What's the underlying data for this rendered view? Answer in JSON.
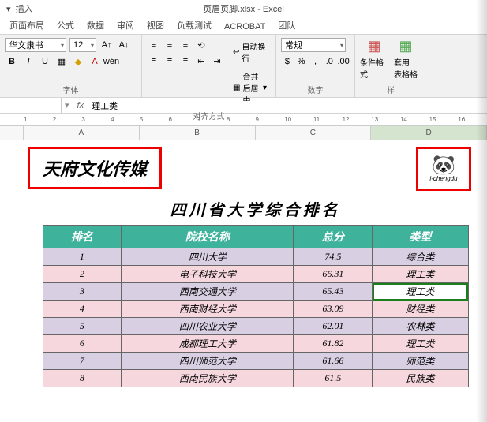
{
  "window": {
    "title": "页眉页脚.xlsx - Excel"
  },
  "qat": {
    "insert": "插入"
  },
  "tabs": [
    "页面布局",
    "公式",
    "数据",
    "审阅",
    "视图",
    "负载测试",
    "ACROBAT",
    "团队"
  ],
  "ribbon": {
    "font": {
      "name": "华文隶书",
      "size": "12",
      "label": "字体"
    },
    "align": {
      "wrap": "自动换行",
      "merge": "合并后居中",
      "label": "对齐方式"
    },
    "number": {
      "format": "常规",
      "label": "数字"
    },
    "styles": {
      "cond": "条件格式",
      "table": "套用\n表格格",
      "label": "样"
    }
  },
  "formula": {
    "cell": "",
    "fx": "fx",
    "value": "理工类"
  },
  "ruler": [
    "1",
    "2",
    "3",
    "4",
    "5",
    "6",
    "7",
    "8",
    "9",
    "10",
    "11",
    "12",
    "13",
    "14",
    "15",
    "16"
  ],
  "cols": [
    "A",
    "B",
    "C",
    "D"
  ],
  "header": {
    "left": "天府文化传媒",
    "brand": "i-chengdu"
  },
  "sheet_title": "四川省大学综合排名",
  "thead": [
    "排名",
    "院校名称",
    "总分",
    "类型"
  ],
  "rows": [
    {
      "rank": "1",
      "name": "四川大学",
      "score": "74.5",
      "type": "综合类"
    },
    {
      "rank": "2",
      "name": "电子科技大学",
      "score": "66.31",
      "type": "理工类"
    },
    {
      "rank": "3",
      "name": "西南交通大学",
      "score": "65.43",
      "type": "理工类"
    },
    {
      "rank": "4",
      "name": "西南财经大学",
      "score": "63.09",
      "type": "财经类"
    },
    {
      "rank": "5",
      "name": "四川农业大学",
      "score": "62.01",
      "type": "农林类"
    },
    {
      "rank": "6",
      "name": "成都理工大学",
      "score": "61.82",
      "type": "理工类"
    },
    {
      "rank": "7",
      "name": "四川师范大学",
      "score": "61.66",
      "type": "师范类"
    },
    {
      "rank": "8",
      "name": "西南民族大学",
      "score": "61.5",
      "type": "民族类"
    }
  ]
}
